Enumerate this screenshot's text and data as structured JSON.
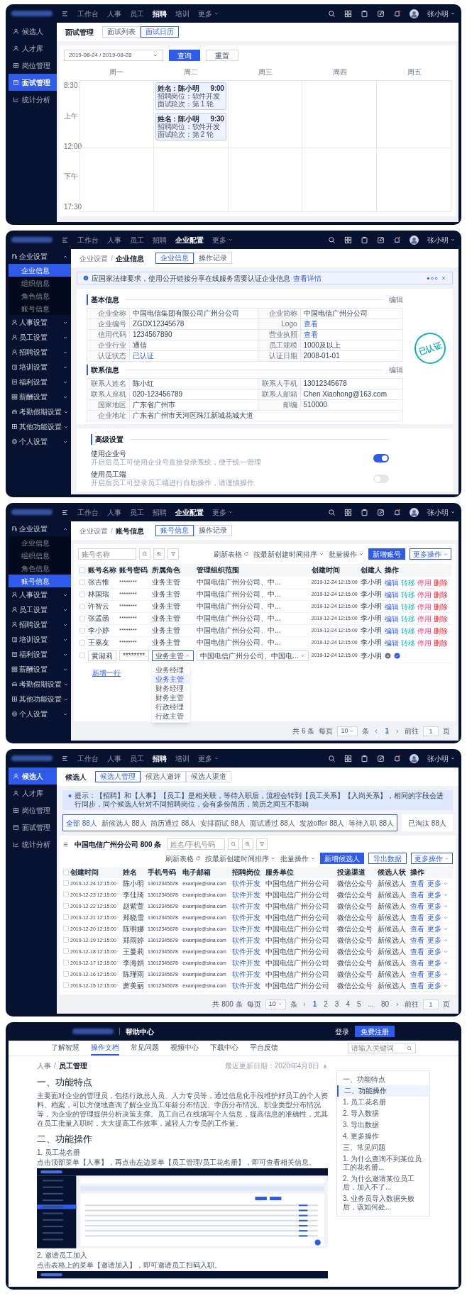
{
  "interview_calendar": {
    "nav": {
      "items": [
        {
          "label": "工作台",
          "selected": false
        },
        {
          "label": "人事",
          "selected": false
        },
        {
          "label": "员工",
          "selected": false
        },
        {
          "label": "招聘",
          "selected": true
        },
        {
          "label": "培训",
          "selected": false
        }
      ],
      "more": "更多",
      "user": "张小明"
    },
    "sidebar": [
      {
        "label": "候选人",
        "selected": false
      },
      {
        "label": "人才库",
        "selected": false
      },
      {
        "label": "岗位管理",
        "selected": false
      },
      {
        "label": "面试管理",
        "selected": true
      },
      {
        "label": "统计分析",
        "selected": false
      }
    ],
    "title": "面试管理",
    "tabs": [
      {
        "label": "面试列表",
        "selected": false
      },
      {
        "label": "面试日历",
        "selected": true
      }
    ],
    "date_range": "2019-08-24 / 2019-08-28",
    "buttons": [
      "查询",
      "重置"
    ],
    "time_labels": [
      "8:30",
      "上午",
      "12:00",
      "下午",
      "17:30"
    ],
    "days": [
      {
        "label": "周一"
      },
      {
        "label": "周二",
        "events": [
          {
            "name": "姓名：陈小明",
            "time": "9:00",
            "lines": [
              "招聘岗位：软件开发",
              "面试轮次：第 1 轮"
            ]
          },
          {
            "name": "姓名：陈小明",
            "time": "9:30",
            "lines": [
              "招聘岗位：软件开发",
              "面试轮次：第 2 轮"
            ]
          }
        ]
      },
      {
        "label": "周三"
      },
      {
        "label": "周四"
      },
      {
        "label": "周五"
      }
    ]
  },
  "company_info": {
    "nav": {
      "items": [
        {
          "label": "工作台",
          "selected": false
        },
        {
          "label": "人事",
          "selected": false
        },
        {
          "label": "员工",
          "selected": false
        },
        {
          "label": "招聘",
          "selected": false
        },
        {
          "label": "企业配置",
          "selected": true
        }
      ],
      "more": "更多",
      "user": "张小明"
    },
    "sidebar": [
      {
        "label": "企业设置",
        "expanded": true,
        "children": [
          {
            "label": "企业信息",
            "selected": true
          },
          {
            "label": "组织信息",
            "selected": false
          },
          {
            "label": "角色信息",
            "selected": false
          },
          {
            "label": "账号信息",
            "selected": false
          }
        ]
      },
      {
        "label": "人事设置",
        "expanded": false
      },
      {
        "label": "员工设置",
        "expanded": false
      },
      {
        "label": "招聘设置",
        "expanded": false
      },
      {
        "label": "培训设置",
        "expanded": false
      },
      {
        "label": "福利设置",
        "expanded": false
      },
      {
        "label": "薪酬设置",
        "expanded": false
      },
      {
        "label": "考勤假期设置",
        "expanded": false
      },
      {
        "label": "其他功能设置",
        "expanded": false
      },
      {
        "label": "个人设置",
        "expanded": false
      }
    ],
    "breadcrumb": {
      "items": [
        "企业设置",
        "企业信息"
      ],
      "separator": "/"
    },
    "tabs": [
      {
        "label": "企业信息",
        "selected": true
      },
      {
        "label": "操作记录",
        "selected": false
      }
    ],
    "notice": {
      "text": "应国家法律要求，使用公开链接分享在线服务需要认证企业信息",
      "link": "查看详情"
    },
    "sections": [
      {
        "title": "基本信息",
        "action": "编辑",
        "fields": [
          {
            "label": "企业全称",
            "value": "中国电信集团有限公司广州分公司",
            "kind": "text"
          },
          {
            "label": "企业简称",
            "value": "中国电信广州分公司",
            "kind": "text"
          },
          {
            "label": "企业编号",
            "value": "ZGDX12345678",
            "kind": "text"
          },
          {
            "label": "Logo",
            "value": "查看",
            "kind": "link"
          },
          {
            "label": "信用代码",
            "value": "1234567890",
            "kind": "text"
          },
          {
            "label": "营业执照",
            "value": "查看",
            "kind": "link"
          },
          {
            "label": "企业行业",
            "value": "通信",
            "kind": "text"
          },
          {
            "label": "员工规模",
            "value": "1000及以上",
            "kind": "text"
          },
          {
            "label": "认证状态",
            "value": "已认证",
            "kind": "link"
          },
          {
            "label": "认证日期",
            "value": "2008-01-01",
            "kind": "text"
          }
        ]
      },
      {
        "title": "联系信息",
        "action": "编辑",
        "fields": [
          {
            "label": "联系人姓名",
            "value": "陈小红",
            "kind": "text"
          },
          {
            "label": "联系人手机",
            "value": "13012345678",
            "kind": "text"
          },
          {
            "label": "联系人座机",
            "value": "020-123456789",
            "kind": "text"
          },
          {
            "label": "联系人邮箱",
            "value": "Chen Xiaohong@163.com",
            "kind": "text"
          },
          {
            "label": "国家地区",
            "value": "广东省广州市",
            "kind": "text"
          },
          {
            "label": "邮编",
            "value": "510000",
            "kind": "text"
          },
          {
            "label": "企业地址",
            "value": "广东省广州市天河区珠江新城花城大道",
            "kind": "text"
          }
        ]
      }
    ],
    "stamp": "已认证",
    "advanced": {
      "title": "高级设置",
      "settings": [
        {
          "label": "使用企业号",
          "description": "开启后员工可使用企业号直接登录系统，便于统一管理",
          "on": true
        },
        {
          "label": "使用员工端",
          "description": "开启后员工可登录员工端进行自助操作，请谨慎操作",
          "on": false
        }
      ]
    }
  },
  "account_info": {
    "nav": {
      "items": [
        {
          "label": "工作台",
          "selected": false
        },
        {
          "label": "人事",
          "selected": false
        },
        {
          "label": "员工",
          "selected": false
        },
        {
          "label": "招聘",
          "selected": false
        },
        {
          "label": "企业配置",
          "selected": true
        }
      ],
      "more": "更多",
      "user": "张小明"
    },
    "sidebar": [
      {
        "label": "企业设置",
        "expanded": true,
        "children": [
          {
            "label": "企业信息",
            "selected": false
          },
          {
            "label": "组织信息",
            "selected": false
          },
          {
            "label": "角色信息",
            "selected": false
          },
          {
            "label": "账号信息",
            "selected": true
          }
        ]
      },
      {
        "label": "人事设置",
        "expanded": false
      },
      {
        "label": "员工设置",
        "expanded": false
      },
      {
        "label": "招聘设置",
        "expanded": false
      },
      {
        "label": "培训设置",
        "expanded": false
      },
      {
        "label": "福利设置",
        "expanded": false
      },
      {
        "label": "薪酬设置",
        "expanded": false
      },
      {
        "label": "考勤假期设置",
        "expanded": false
      },
      {
        "label": "其他功能设置",
        "expanded": false
      },
      {
        "label": "个人设置",
        "expanded": false
      }
    ],
    "breadcrumb": {
      "items": [
        "企业设置",
        "账号信息"
      ],
      "separator": "/"
    },
    "tabs": [
      {
        "label": "账号信息",
        "selected": true
      },
      {
        "label": "操作记录",
        "selected": false
      }
    ],
    "search_placeholder": "账号名称",
    "actions": [
      "刷新表格",
      "按最新创建时间排序",
      "批量操作"
    ],
    "primary": "新增账号",
    "more": "更多操作",
    "all_checked": false,
    "columns": [
      "账号名称",
      "账号密码",
      "所属角色",
      "管理组织范围",
      "创建时间",
      "创建人",
      "操作"
    ],
    "rows": [
      {
        "checked": false,
        "cells": [
          "张吉惟",
          "********",
          "业务主管",
          "中国电信广州分公司、中...",
          "2019-12-24 12:15:00",
          "李小明"
        ],
        "actions": [
          "编辑",
          "转移",
          "停用",
          "删除"
        ]
      },
      {
        "checked": false,
        "cells": [
          "林国瑞",
          "********",
          "业务主管",
          "中国电信广州分公司、中...",
          "2019-12-24 12:15:00",
          "李小明"
        ],
        "actions": [
          "编辑",
          "转移",
          "停用",
          "删除"
        ]
      },
      {
        "checked": false,
        "cells": [
          "许智云",
          "********",
          "业务主管",
          "中国电信广州分公司、中...",
          "2019-12-24 12:15:00",
          "李小明"
        ],
        "actions": [
          "编辑",
          "转移",
          "停用",
          "删除"
        ]
      },
      {
        "checked": false,
        "cells": [
          "张孟函",
          "********",
          "业务主管",
          "中国电信广州分公司、中...",
          "2019-12-24 12:15:00",
          "李小明"
        ],
        "actions": [
          "编辑",
          "转移",
          "停用",
          "删除"
        ]
      },
      {
        "checked": false,
        "cells": [
          "李小婷",
          "********",
          "业务主管",
          "中国电信广州分公司、中...",
          "2019-12-24 12:15:00",
          "李小明"
        ],
        "actions": [
          "编辑",
          "转移",
          "停用",
          "删除"
        ]
      },
      {
        "checked": false,
        "cells": [
          "王嘉友",
          "********",
          "业务主管",
          "中国电信广州分公司、中...",
          "2019-12-24 12:15:00",
          "李小明"
        ],
        "actions": [
          "编辑",
          "转移",
          "停用",
          "删除"
        ]
      }
    ],
    "editing_row": {
      "checked": false,
      "name": "黄淑莉",
      "password": "********",
      "role": "业务主管",
      "scope": "中国电信广州分公司、中国电...",
      "time": "2019-12-24 12:15:00",
      "creator": "李小明"
    },
    "role_options": [
      {
        "label": "业务经理",
        "selected": false
      },
      {
        "label": "业务主管",
        "selected": true
      },
      {
        "label": "财务经理",
        "selected": false
      },
      {
        "label": "财务主管",
        "selected": false
      },
      {
        "label": "行政经理",
        "selected": false
      },
      {
        "label": "行政主管",
        "selected": false
      }
    ],
    "add_row": "新增一行",
    "pagination": {
      "total": "共 6 条",
      "per_page_label": "每页",
      "per_page": "10",
      "unit": "条",
      "pages": [
        {
          "label": "1",
          "selected": true
        }
      ],
      "goto_label": "前往",
      "goto_value": "1",
      "goto_unit": "页"
    }
  },
  "candidates": {
    "nav": {
      "items": [
        {
          "label": "工作台",
          "selected": false
        },
        {
          "label": "人事",
          "selected": false
        },
        {
          "label": "员工",
          "selected": false
        },
        {
          "label": "招聘",
          "selected": true
        },
        {
          "label": "培训",
          "selected": false
        }
      ],
      "more": "更多",
      "user": "张小明"
    },
    "sidebar": [
      {
        "label": "候选人",
        "selected": true
      },
      {
        "label": "人才库",
        "selected": false
      },
      {
        "label": "岗位管理",
        "selected": false
      },
      {
        "label": "面试管理",
        "selected": false
      },
      {
        "label": "统计分析",
        "selected": false
      }
    ],
    "title": "候选人",
    "tabs": [
      {
        "label": "候选人管理",
        "selected": true
      },
      {
        "label": "候选人邀评",
        "selected": false
      },
      {
        "label": "候选人渠道",
        "selected": false
      }
    ],
    "notice": "提示：【招聘】和【人事】【员工】是相关联，等待入职后，流程会转到【员工关系】【入岗关系】，相同的字段会进行同步，同个候选人针对不同招聘岗位，会有多份简历，简历之间互不影响",
    "statuses": [
      {
        "label": "全部 88人",
        "selected": true
      },
      {
        "label": "新候选人 88人",
        "selected": false
      },
      {
        "label": "简历通过 88人",
        "selected": false
      },
      {
        "label": "安排面试 88人",
        "selected": false
      },
      {
        "label": "面试通过 88人",
        "selected": false
      },
      {
        "label": "发放offer 88人",
        "selected": false
      },
      {
        "label": "等待入职 88人",
        "selected": false
      }
    ],
    "archived": {
      "label": "已淘汰 88人",
      "selected": false
    },
    "table_title": "中国电信广州分公司 800 条",
    "search_placeholder": "姓名/手机号码",
    "actions": [
      "刷新表格",
      "按最新创建时间排序",
      "批量操作"
    ],
    "primary": "新增候选人",
    "export": "导出数据",
    "more": "更多操作",
    "all_checked": false,
    "columns": [
      "创建时间",
      "姓名",
      "手机号码",
      "电子邮箱",
      "招聘岗位",
      "服务单位",
      "投递渠道",
      "候选人状",
      "操作"
    ],
    "rows": [
      {
        "checked": false,
        "cells": [
          "2019-12-24 12:15:00",
          "陈小明",
          "13012345678",
          "example@sina.com",
          "软件开发",
          "中国电信广州分公司",
          "微信公众号",
          "新候选人"
        ],
        "actions": [
          "查看",
          "更多"
        ]
      },
      {
        "checked": false,
        "cells": [
          "2019-12-23 12:15:00",
          "李佳琦",
          "13012345678",
          "example@sina.com",
          "软件开发",
          "中国电信广州分公司",
          "微信公众号",
          "新候选人"
        ],
        "actions": [
          "查看",
          "更多"
        ]
      },
      {
        "checked": false,
        "cells": [
          "2019-12-22 12:15:00",
          "赵紫萱",
          "13012345678",
          "example@sina.com",
          "软件开发",
          "中国电信广州分公司",
          "微信公众号",
          "新候选人"
        ],
        "actions": [
          "查看",
          "更多"
        ]
      },
      {
        "checked": false,
        "cells": [
          "2019-12-21 12:15:00",
          "郑晓雪",
          "13012345678",
          "example@sina.com",
          "软件开发",
          "中国电信广州分公司",
          "微信公众号",
          "新候选人"
        ],
        "actions": [
          "查看",
          "更多"
        ]
      },
      {
        "checked": false,
        "cells": [
          "2019-12-20 12:15:00",
          "陈明娜",
          "13012345678",
          "example@sina.com",
          "软件开发",
          "中国电信广州分公司",
          "微信公众号",
          "新候选人"
        ],
        "actions": [
          "查看",
          "更多"
        ]
      },
      {
        "checked": false,
        "cells": [
          "2019-12-19 12:15:00",
          "郑雨婷",
          "13012345678",
          "example@sina.com",
          "软件开发",
          "中国电信广州分公司",
          "微信公众号",
          "新候选人"
        ],
        "actions": [
          "查看",
          "更多"
        ]
      },
      {
        "checked": false,
        "cells": [
          "2019-12-18 12:15:00",
          "王曼莉",
          "13012345678",
          "example@sina.com",
          "软件开发",
          "中国电信广州分公司",
          "微信公众号",
          "新候选人"
        ],
        "actions": [
          "查看",
          "更多"
        ]
      },
      {
        "checked": false,
        "cells": [
          "2019-12-17 12:15:00",
          "李海娟",
          "13012345678",
          "example@sina.com",
          "软件开发",
          "中国电信广州分公司",
          "微信公众号",
          "新候选人"
        ],
        "actions": [
          "查看",
          "更多"
        ]
      },
      {
        "checked": false,
        "cells": [
          "2019-12-16 12:15:00",
          "陈瑾雨",
          "13012345678",
          "example@sina.com",
          "软件开发",
          "中国电信广州分公司",
          "微信公众号",
          "新候选人"
        ],
        "actions": [
          "查看",
          "更多"
        ]
      },
      {
        "checked": false,
        "cells": [
          "2019-12-15 12:15:00",
          "萧美丽",
          "13012345678",
          "example@sina.com",
          "软件开发",
          "中国电信广州分公司",
          "微信公众号",
          "新候选人"
        ],
        "actions": [
          "查看",
          "更多"
        ]
      }
    ],
    "pagination": {
      "total": "共 800 条",
      "per_page_label": "每页",
      "per_page": "10",
      "unit": "条",
      "pages": [
        {
          "label": "1",
          "selected": true
        },
        {
          "label": "2",
          "selected": false
        },
        {
          "label": "3",
          "selected": false
        },
        {
          "label": "4",
          "selected": false
        },
        {
          "label": "5",
          "selected": false
        },
        {
          "label": "...",
          "selected": false
        },
        {
          "label": "80",
          "selected": false
        }
      ],
      "goto_label": "前往",
      "goto_value": "1",
      "goto_unit": "页"
    }
  },
  "help_center": {
    "header": {
      "title": "帮助中心",
      "login": "登录",
      "register": "免费注册"
    },
    "tabs": [
      {
        "label": "了解智慧",
        "selected": false
      },
      {
        "label": "操作文档",
        "selected": true
      },
      {
        "label": "常见问题",
        "selected": false
      },
      {
        "label": "视频中心",
        "selected": false
      },
      {
        "label": "下载中心",
        "selected": false
      },
      {
        "label": "平台反馈",
        "selected": false
      }
    ],
    "search_placeholder": "请输入关键词",
    "breadcrumb": {
      "items": [
        "人事",
        "员工管理"
      ],
      "separator": "/"
    },
    "updated": "最近更新日期：2020年4月8日",
    "article": [
      {
        "kind": "heading",
        "text": "一、功能特点"
      },
      {
        "kind": "paragraph",
        "text": "主要面对企业的管理员，包括行政总人员、人力专员等，通过信息化手段维护好员工的个人资料、档案，可以方便地查询了解企业员工年龄分布情况、学历分布情况、职业类型分布情况等，为企业的管理提供分析决策支撑。员工自己在线填写个人信息，提高信息的准确性，尤其在员工批量入职时，大大提高工作效率，减轻人力专员的工作量。"
      },
      {
        "kind": "heading",
        "text": "二、功能操作"
      },
      {
        "kind": "step",
        "text": "1. 员工花名册"
      },
      {
        "kind": "paragraph",
        "text": "点击顶部菜单【人事】，再点击左边菜单【员工管理/员工花名册】，即可查看相关信息。"
      },
      {
        "kind": "screenshot"
      },
      {
        "kind": "step",
        "text": "2. 邀请员工加入"
      },
      {
        "kind": "paragraph",
        "text": "点击表格上的菜单【邀请加入】，即可邀请员工扫码入职。"
      },
      {
        "kind": "screenshot_strip"
      }
    ],
    "toc": [
      {
        "label": "一、功能特点",
        "selected": false
      },
      {
        "label": "二、功能操作",
        "selected": true
      },
      {
        "label": "1. 员工花名册",
        "selected": false
      },
      {
        "label": "2. 导入数据",
        "selected": false
      },
      {
        "label": "3. 导出数据",
        "selected": false
      },
      {
        "label": "4. 更多操作",
        "selected": false
      },
      {
        "label": "三、常见问题",
        "selected": false
      },
      {
        "label": "1. 为什么查询不到某位员工的花名册...",
        "selected": false
      },
      {
        "label": "2. 为什么邀请某位员工后，加入不了...",
        "selected": false
      },
      {
        "label": "3. 业务员导入数据失败后，该如何处...",
        "selected": false
      }
    ]
  }
}
